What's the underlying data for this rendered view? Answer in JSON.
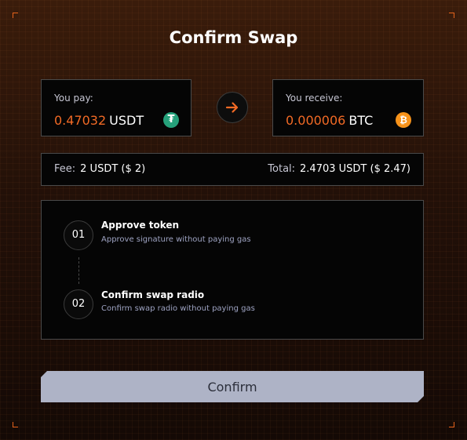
{
  "title": "Confirm Swap",
  "pay": {
    "label": "You pay:",
    "amount": "0.47032",
    "unit": "USDT",
    "icon": "tether-icon",
    "icon_glyph": "₮",
    "icon_color": "#26a17b"
  },
  "receive": {
    "label": "You receive:",
    "amount": "0.000006",
    "unit": "BTC",
    "icon": "bitcoin-icon",
    "icon_glyph": "₿",
    "icon_color": "#f7931a"
  },
  "swap_arrow_icon": "arrow-right-icon",
  "fee": {
    "label": "Fee:",
    "value": "2 USDT ($ 2)"
  },
  "total": {
    "label": "Total:",
    "value": "2.4703 USDT ($ 2.47)"
  },
  "steps": [
    {
      "number": "01",
      "title": "Approve token",
      "description": "Approve signature without paying gas"
    },
    {
      "number": "02",
      "title": "Confirm swap radio",
      "description": "Confirm swap radio without paying gas"
    }
  ],
  "confirm_label": "Confirm",
  "colors": {
    "accent": "#f26a25",
    "button_bg": "#aeb3c6",
    "panel_bg": "#050505",
    "border": "#4a4a4a"
  }
}
